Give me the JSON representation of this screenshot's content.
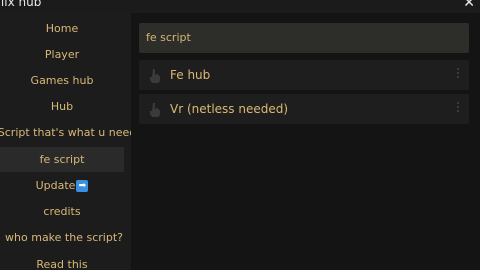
{
  "window": {
    "title": "Flix hub",
    "close_glyph": "✕"
  },
  "sidebar": {
    "items": [
      {
        "label": "Home"
      },
      {
        "label": "Player"
      },
      {
        "label": "Games hub"
      },
      {
        "label": "Hub"
      },
      {
        "label": "Script that's what u need"
      },
      {
        "label": "fe script",
        "active": true
      },
      {
        "label": "Update",
        "icon": "arrow-right-icon",
        "icon_glyph": "➡"
      },
      {
        "label": "credits"
      },
      {
        "label": "who make the script?"
      },
      {
        "label": "Read this"
      }
    ]
  },
  "search": {
    "value": "fe script"
  },
  "results": [
    {
      "label": "Fe hub",
      "icon": "hand-pointer-icon"
    },
    {
      "label": "Vr (netless needed)",
      "icon": "hand-pointer-icon"
    }
  ],
  "colors": {
    "accent_text": "#d8b878",
    "background": "#141414",
    "sidebar": "#1c1c1c",
    "active_item": "#2a2a2a",
    "search_bg": "#2d2d2a",
    "result_bg": "#1e1e1e"
  }
}
